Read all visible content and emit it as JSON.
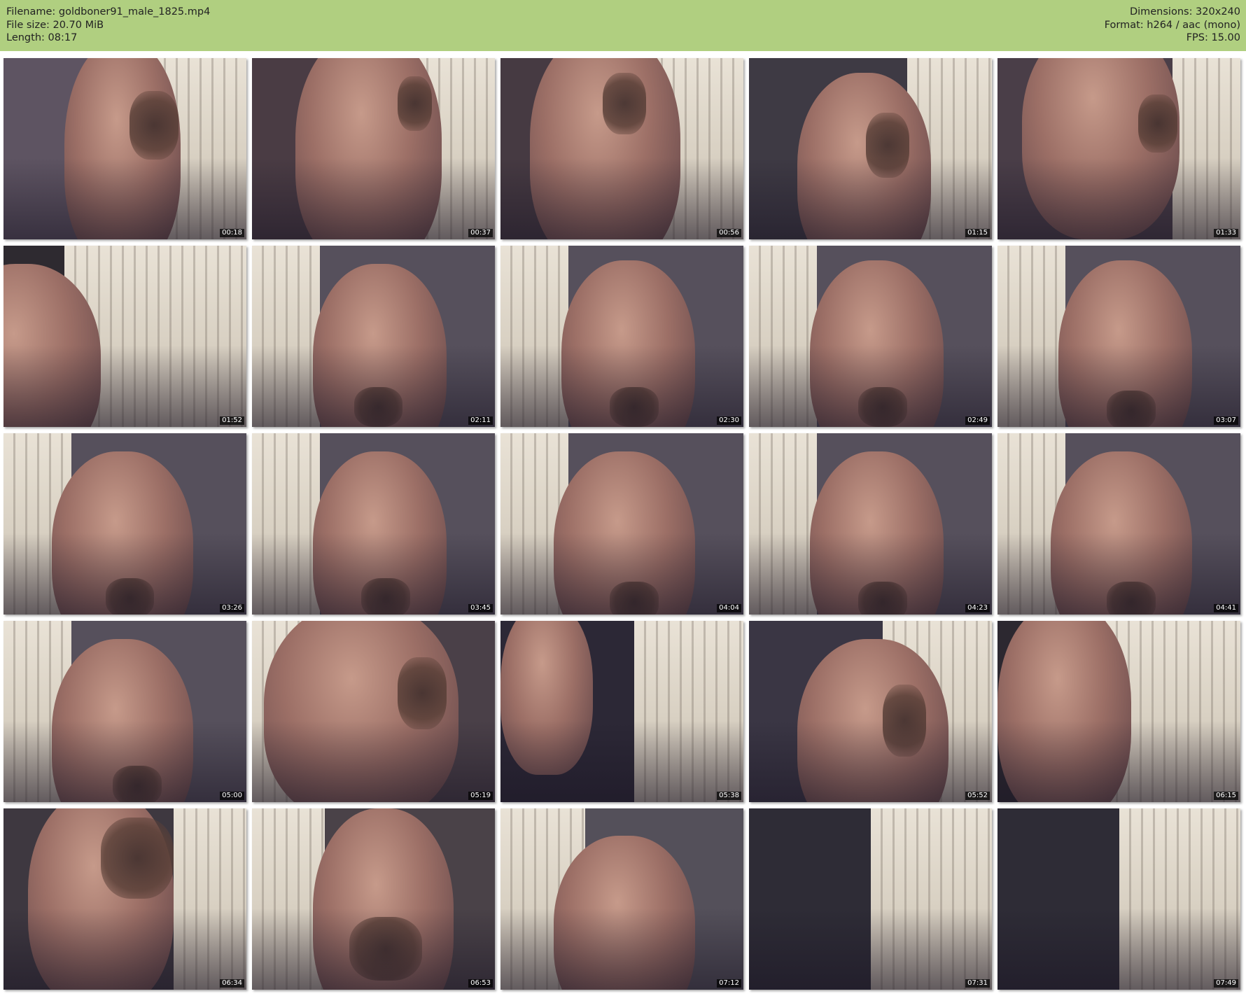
{
  "header": {
    "filename": "Filename: goldboner91_male_1825.mp4",
    "filesize": "File size: 20.70 MiB",
    "length": "Length: 08:17",
    "dimensions": "Dimensions: 320x240",
    "format": "Format: h264 / aac (mono)",
    "fps": "FPS: 15.00",
    "background_color": "#b0cf80"
  },
  "thumbnails": [
    {
      "time": "00:18"
    },
    {
      "time": "00:37"
    },
    {
      "time": "00:56"
    },
    {
      "time": "01:15"
    },
    {
      "time": "01:33"
    },
    {
      "time": "01:52"
    },
    {
      "time": "02:11"
    },
    {
      "time": "02:30"
    },
    {
      "time": "02:49"
    },
    {
      "time": "03:07"
    },
    {
      "time": "03:26"
    },
    {
      "time": "03:45"
    },
    {
      "time": "04:04"
    },
    {
      "time": "04:23"
    },
    {
      "time": "04:41"
    },
    {
      "time": "05:00"
    },
    {
      "time": "05:19"
    },
    {
      "time": "05:38"
    },
    {
      "time": "05:52"
    },
    {
      "time": "06:15"
    },
    {
      "time": "06:34"
    },
    {
      "time": "06:53"
    },
    {
      "time": "07:12"
    },
    {
      "time": "07:31"
    },
    {
      "time": "07:49"
    }
  ]
}
